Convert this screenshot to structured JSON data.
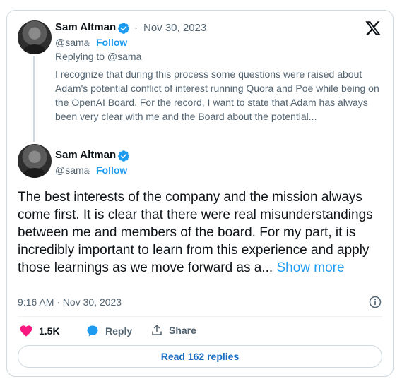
{
  "reply_tweet": {
    "author_name": "Sam Altman",
    "separator": "·",
    "date": "Nov 30, 2023",
    "handle": "@sama",
    "follow": "Follow",
    "replying_to": "Replying to @sama",
    "text": "I recognize that during this process some questions were raised about Adam's potential conflict of interest running Quora and Poe while being on the OpenAI Board. For the record, I want to state that Adam has always been very clear with me and the Board about the potential..."
  },
  "main_tweet": {
    "author_name": "Sam Altman",
    "handle": "@sama",
    "follow": "Follow",
    "text": "The best interests of the company and the mission always come first. It is clear that there were real misunderstandings between me and members of the board. For my part, it is incredibly important to learn from this experience and apply those learnings as we move forward as a...",
    "show_more": "Show more",
    "timestamp": "9:16 AM · Nov 30, 2023"
  },
  "actions": {
    "likes": "1.5K",
    "reply": "Reply",
    "share": "Share"
  },
  "read_replies": "Read 162 replies",
  "colors": {
    "accent": "#1d9bf0",
    "like": "#f91880",
    "text": "#0f1419",
    "muted": "#536471",
    "border": "#cfd9de"
  },
  "icons": [
    "verified-badge-icon",
    "x-logo-icon",
    "info-icon",
    "heart-icon",
    "reply-bubble-icon",
    "share-icon"
  ]
}
